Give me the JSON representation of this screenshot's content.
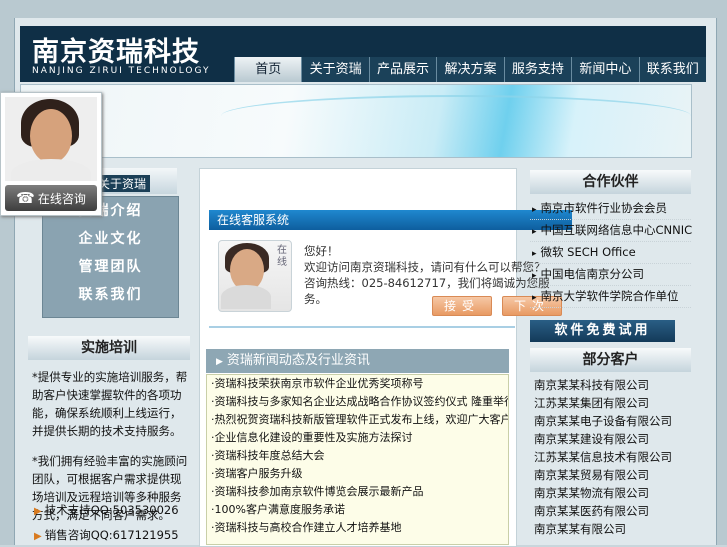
{
  "brand": {
    "cn": "南京资瑞科技",
    "en": "NANJING ZIRUI TECHNOLOGY"
  },
  "nav": [
    "首页",
    "关于资瑞",
    "产品展示",
    "解决方案",
    "服务支持",
    "新闻中心",
    "联系我们"
  ],
  "left": {
    "head_label": "关于资瑞",
    "menu": [
      "资瑞介绍",
      "企业文化",
      "管理团队",
      "联系我们"
    ]
  },
  "training": {
    "title": "实施培训",
    "paragraphs": [
      "*提供专业的实施培训服务，帮助客户快速掌握软件的各项功能，确保系统顺利上线运行，并提供长期的技术支持服务。",
      "*我们拥有经验丰富的实施顾问团队，可根据客户需求提供现场培训及远程培训等多种服务方式，满足不同客户需求。"
    ],
    "qq": [
      "技术支持QQ:503530026",
      "销售咨询QQ:617121955"
    ]
  },
  "chat": {
    "bar_title": "在线客服系统",
    "photo_label": "在线",
    "greeting": "您好！",
    "message": "欢迎访问南京资瑞科技，请问有什么可以帮您？咨询热线：025-84612717，我们将竭诚为您服务。",
    "accept": "接受",
    "later": "下次"
  },
  "news": {
    "title": "资瑞新闻动态及行业资讯",
    "items": [
      "·资瑞科技荣获南京市软件企业优秀奖项称号",
      "·资瑞科技与多家知名企业达成战略合作协议签约仪式 隆重举行圆满成功并获得各界好评",
      "·热烈祝贺资瑞科技新版管理软件正式发布上线，欢迎广大客户试用",
      "·企业信息化建设的重要性及实施方法探讨",
      "·资瑞科技年度总结大会",
      "·资瑞客户服务升级",
      "·资瑞科技参加南京软件博览会展示最新产品",
      "·100%客户满意度服务承诺",
      "·资瑞科技与高校合作建立人才培养基地"
    ]
  },
  "partners": {
    "title": "合作伙伴",
    "items": [
      "南京市软件行业协会会员",
      "中国互联网络信息中心CNNIC",
      "微软 SECH Office",
      "中国电信南京分公司",
      "南京大学软件学院合作单位"
    ]
  },
  "trial_label": "软件免费试用",
  "clients": {
    "title": "部分客户",
    "items": [
      "南京某某科技有限公司",
      "江苏某某集团有限公司",
      "南京某某电子设备有限公司",
      "南京某某建设有限公司",
      "江苏某某信息技术有限公司",
      "南京某某贸易有限公司",
      "南京某某物流有限公司",
      "南京某某医药有限公司",
      "南京某某有限公司"
    ]
  },
  "float_widget": {
    "label": "在线咨询"
  }
}
